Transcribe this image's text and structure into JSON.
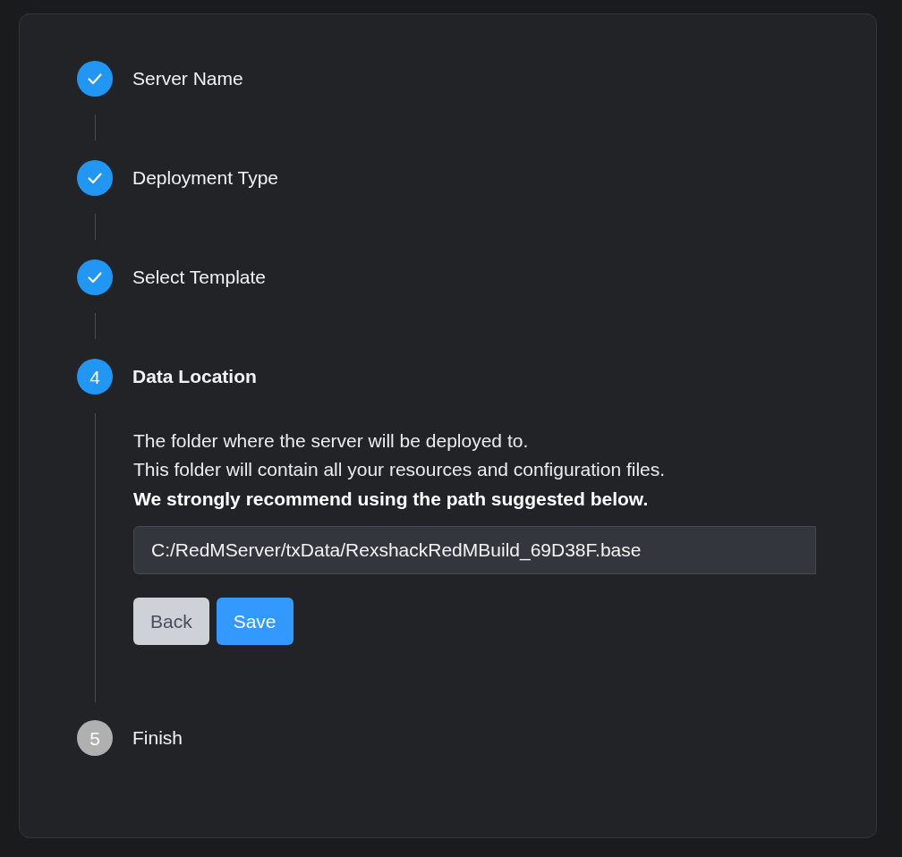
{
  "stepper": {
    "steps": [
      {
        "label": "Server Name",
        "completed": true,
        "selected": false
      },
      {
        "label": "Deployment Type",
        "completed": true,
        "selected": false
      },
      {
        "label": "Select Template",
        "completed": true,
        "selected": false
      },
      {
        "number": "4",
        "label": "Data Location",
        "completed": false,
        "selected": true,
        "description": [
          "The folder where the server will be deployed to.",
          "This folder will contain all your resources and configuration files."
        ],
        "recommendation": "We strongly recommend using the path suggested below.",
        "path_field": {
          "value": "C:/RedMServer/txData/RexshackRedMBuild_69D38F.base"
        },
        "buttons": [
          {
            "label": "Back",
            "kind": "secondary"
          },
          {
            "label": "Save",
            "kind": "primary"
          }
        ]
      },
      {
        "number": "5",
        "label": "Finish",
        "completed": false,
        "selected": false
      }
    ]
  }
}
